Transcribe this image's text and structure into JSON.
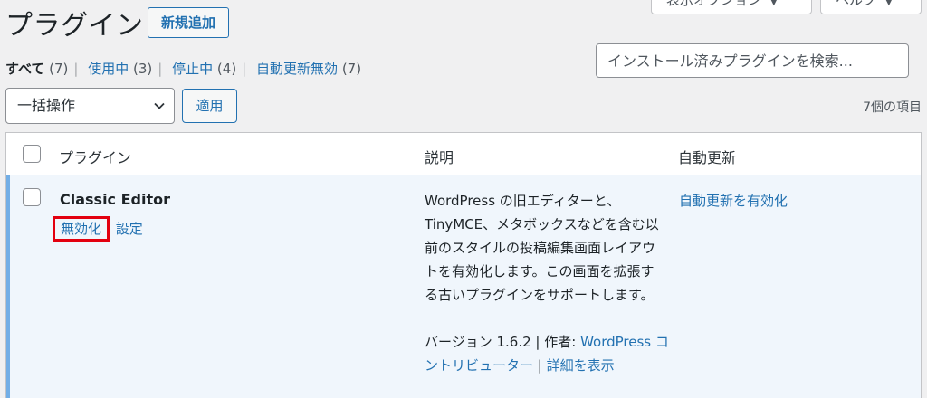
{
  "screen_meta": {
    "options_label": "表示オプション",
    "help_label": "ヘルプ"
  },
  "header": {
    "title": "プラグイン",
    "add_new_label": "新規追加"
  },
  "filters": [
    {
      "label": "すべて",
      "count": "(7)",
      "current": true
    },
    {
      "label": "使用中",
      "count": "(3)",
      "current": false
    },
    {
      "label": "停止中",
      "count": "(4)",
      "current": false
    },
    {
      "label": "自動更新無効",
      "count": "(7)",
      "current": false
    }
  ],
  "search": {
    "placeholder": "インストール済みプラグインを検索..."
  },
  "bulk": {
    "selected": "一括操作",
    "apply_label": "適用",
    "items_count": "7個の項目"
  },
  "table": {
    "columns": {
      "plugin": "プラグイン",
      "description": "説明",
      "auto_update": "自動更新"
    },
    "rows": [
      {
        "name": "Classic Editor",
        "actions": {
          "deactivate": "無効化",
          "settings": "設定"
        },
        "description": "WordPress の旧エディターと、TinyMCE、メタボックスなどを含む以前のスタイルの投稿編集画面レイアウトを有効化します。この画面を拡張する古いプラグインをサポートします。",
        "version_text": "バージョン 1.6.2 | 作者: ",
        "author": "WordPress コントリビューター",
        "separator": " | ",
        "details": "詳細を表示",
        "auto_update": "自動更新を有効化"
      }
    ]
  },
  "colors": {
    "link": "#2271b1",
    "active_row_bg": "#f0f6fc",
    "active_row_border": "#72aee6",
    "highlight_box": "#e3000f"
  }
}
